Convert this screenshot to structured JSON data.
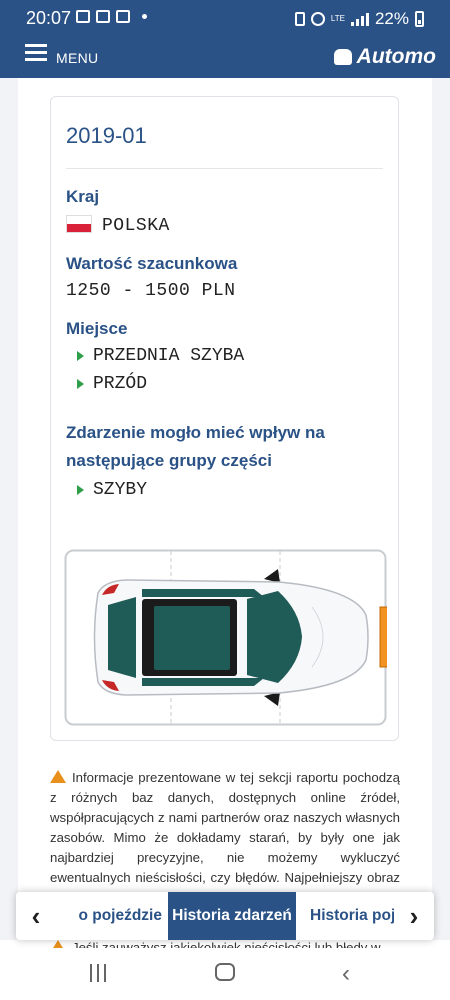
{
  "status_bar": {
    "time": "20:07",
    "battery": "22%",
    "network": "LTE"
  },
  "header": {
    "menu_label": "MENU",
    "logo_text": "Automo"
  },
  "record": {
    "date": "2019-01",
    "country_label": "Kraj",
    "country_value": "POLSKA",
    "value_label": "Wartość szacunkowa",
    "value_amount": "1250 - 1500 PLN",
    "place_label": "Miejsce",
    "place_items": [
      "PRZEDNIA SZYBA",
      "PRZÓD"
    ],
    "parts_label_line1": "Zdarzenie mogło mieć wpływ na",
    "parts_label_line2": "następujące grupy części",
    "parts_items": [
      "SZYBY"
    ]
  },
  "disclaimer": {
    "text": "Informacje prezentowane w tej sekcji raportu pochodzą z różnych baz danych, dostępnych online źródeł, współpracujących z nami partnerów oraz naszych własnych zasobów. Mimo że dokładamy starań, by były one jak najbardziej precyzyjne, nie możemy wykluczyć ewentualnych nieścisłości, czy błędów. Najpełniejszy obraz stanu pojazdu uzyskasz dokonując bezpośrednich oględzin",
    "next_text": "Jeśli zauważysz jakiekolwiek nieścisłości lub błędy w"
  },
  "tabs": {
    "left": "o pojeździe",
    "active": "Historia zdarzeń",
    "right": "Historia poja"
  },
  "colors": {
    "brand": "#2a5286",
    "highlight": "#f29220",
    "flag_red": "#d9213a",
    "bullet": "#2e9e49"
  }
}
